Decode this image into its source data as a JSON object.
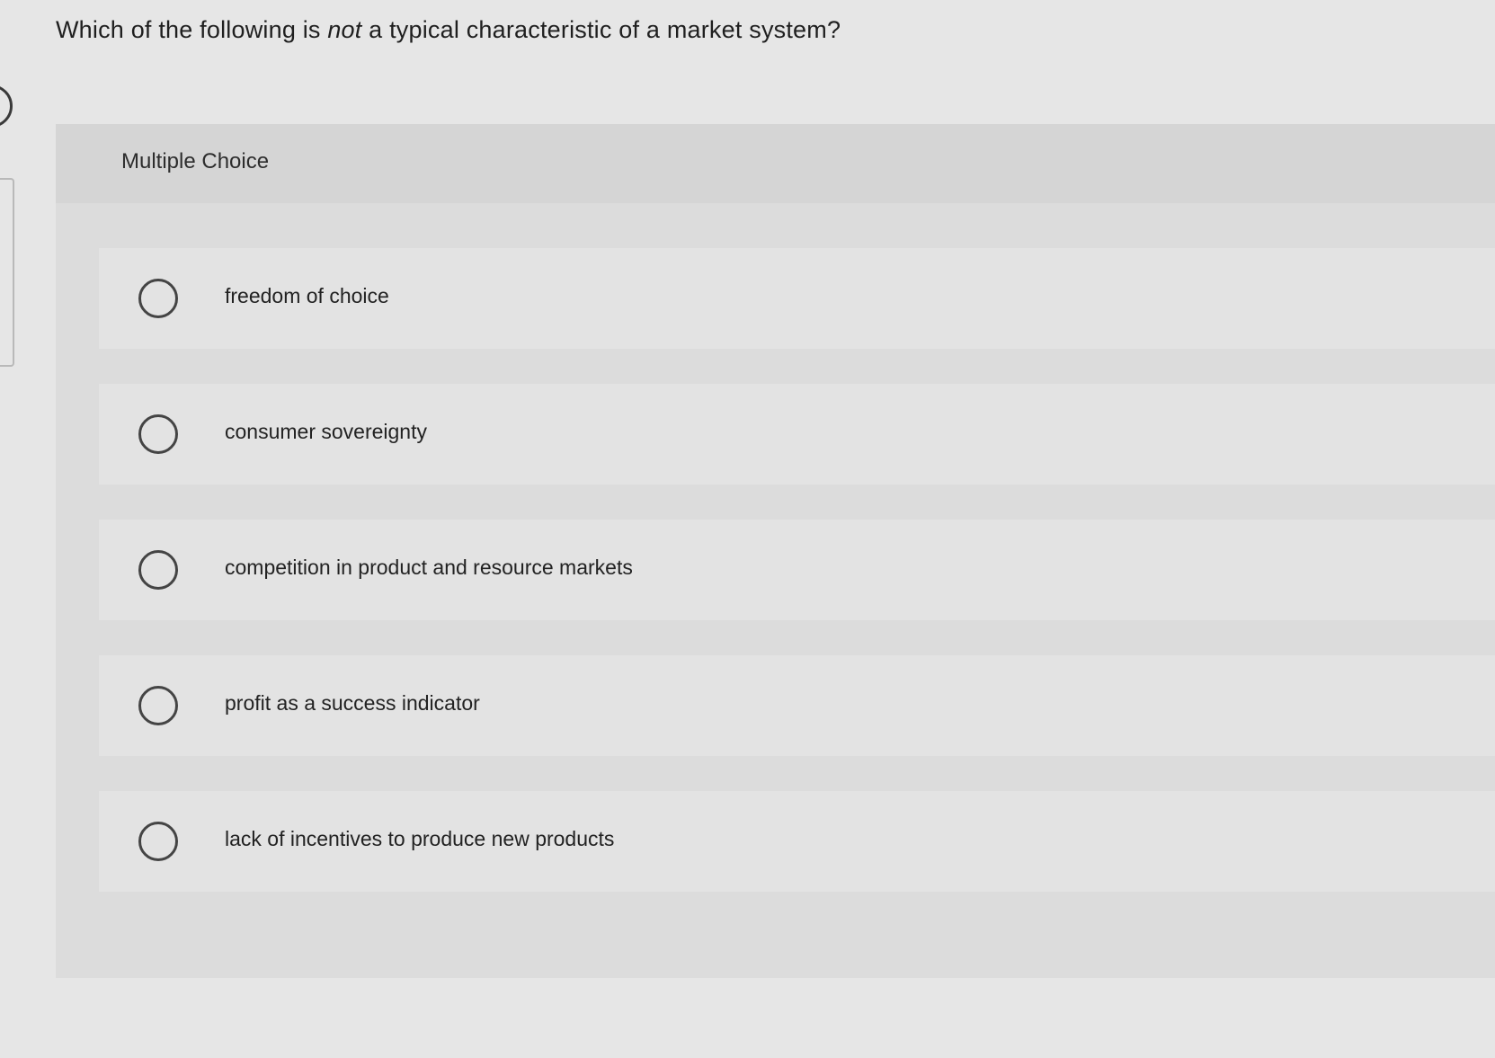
{
  "question": {
    "before": "Which of the following is ",
    "emphasis": "not",
    "after": " a typical characteristic of a market system?"
  },
  "section": {
    "label": "Multiple Choice"
  },
  "choices": [
    {
      "label": "freedom of choice"
    },
    {
      "label": "consumer sovereignty"
    },
    {
      "label": "competition in product and resource markets"
    },
    {
      "label": "profit as a success indicator"
    },
    {
      "label": "lack of incentives to produce new products"
    }
  ],
  "icons": {
    "radio": "radio-button-icon",
    "left_edge": "ring-icon"
  },
  "colors": {
    "background": "#e6e6e6",
    "panel": "#dcdcdc",
    "choice_row": "#e3e3e3",
    "text": "#222222"
  }
}
